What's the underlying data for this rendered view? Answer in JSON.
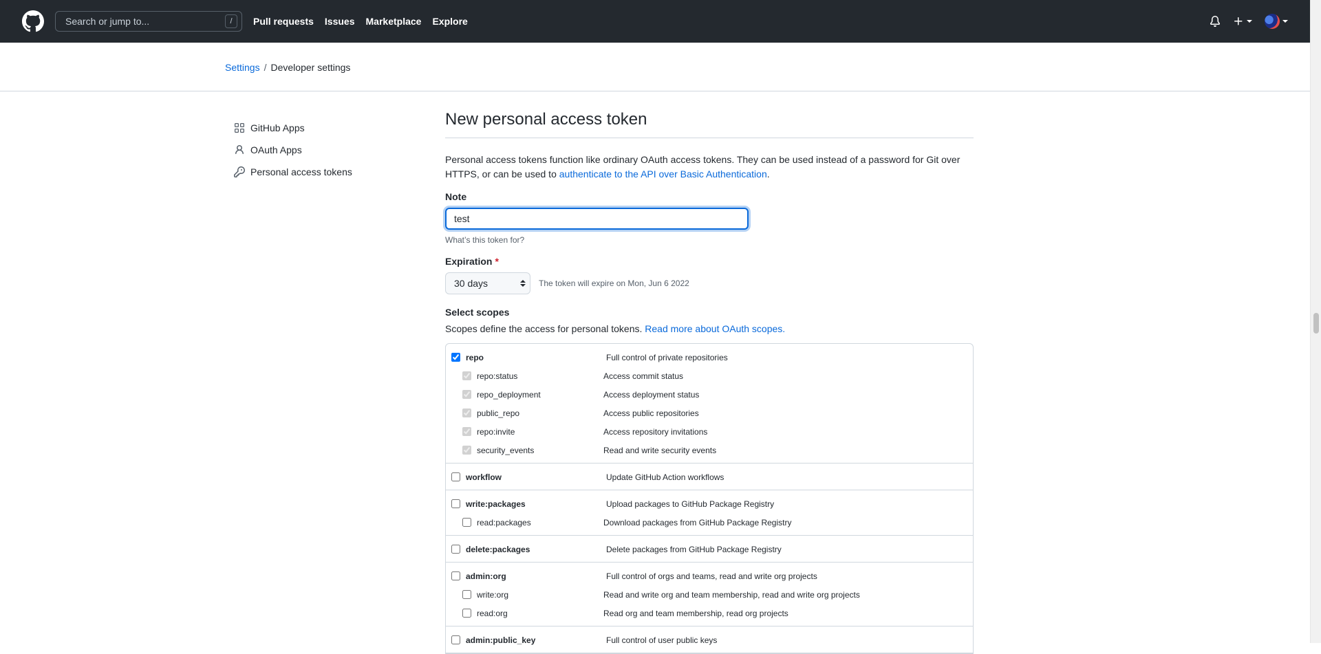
{
  "header": {
    "search_placeholder": "Search or jump to...",
    "search_shortcut": "/",
    "nav": [
      "Pull requests",
      "Issues",
      "Marketplace",
      "Explore"
    ]
  },
  "breadcrumb": {
    "parent": "Settings",
    "separator": "/",
    "current": "Developer settings"
  },
  "sidebar": {
    "items": [
      {
        "label": "GitHub Apps",
        "icon": "apps-icon"
      },
      {
        "label": "OAuth Apps",
        "icon": "person-icon"
      },
      {
        "label": "Personal access tokens",
        "icon": "key-icon"
      }
    ]
  },
  "main": {
    "title": "New personal access token",
    "intro_text": "Personal access tokens function like ordinary OAuth access tokens. They can be used instead of a password for Git over HTTPS, or can be used to ",
    "intro_link": "authenticate to the API over Basic Authentication",
    "intro_end": ".",
    "note_label": "Note",
    "note_value": "test",
    "note_hint": "What’s this token for?",
    "expiration_label": "Expiration",
    "expiration_required": "*",
    "expiration_value": "30 days",
    "expiration_note": "The token will expire on Mon, Jun 6 2022",
    "scopes_label": "Select scopes",
    "scopes_desc": "Scopes define the access for personal tokens. ",
    "scopes_link": "Read more about OAuth scopes."
  },
  "scopes": [
    {
      "name": "repo",
      "desc": "Full control of private repositories",
      "checked": true,
      "children": [
        {
          "name": "repo:status",
          "desc": "Access commit status",
          "checked": true,
          "disabled": true
        },
        {
          "name": "repo_deployment",
          "desc": "Access deployment status",
          "checked": true,
          "disabled": true
        },
        {
          "name": "public_repo",
          "desc": "Access public repositories",
          "checked": true,
          "disabled": true
        },
        {
          "name": "repo:invite",
          "desc": "Access repository invitations",
          "checked": true,
          "disabled": true
        },
        {
          "name": "security_events",
          "desc": "Read and write security events",
          "checked": true,
          "disabled": true
        }
      ]
    },
    {
      "name": "workflow",
      "desc": "Update GitHub Action workflows",
      "checked": false,
      "children": []
    },
    {
      "name": "write:packages",
      "desc": "Upload packages to GitHub Package Registry",
      "checked": false,
      "children": [
        {
          "name": "read:packages",
          "desc": "Download packages from GitHub Package Registry",
          "checked": false,
          "disabled": false
        }
      ]
    },
    {
      "name": "delete:packages",
      "desc": "Delete packages from GitHub Package Registry",
      "checked": false,
      "children": []
    },
    {
      "name": "admin:org",
      "desc": "Full control of orgs and teams, read and write org projects",
      "checked": false,
      "children": [
        {
          "name": "write:org",
          "desc": "Read and write org and team membership, read and write org projects",
          "checked": false,
          "disabled": false
        },
        {
          "name": "read:org",
          "desc": "Read org and team membership, read org projects",
          "checked": false,
          "disabled": false
        }
      ]
    },
    {
      "name": "admin:public_key",
      "desc": "Full control of user public keys",
      "checked": false,
      "children": []
    }
  ]
}
